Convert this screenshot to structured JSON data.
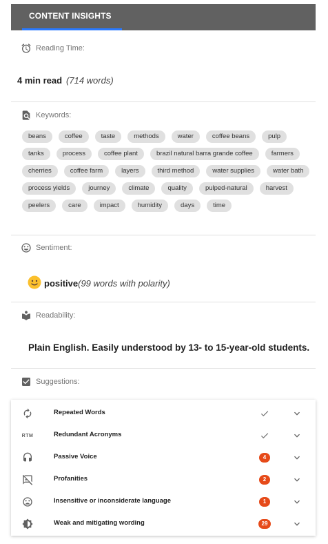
{
  "header": {
    "tab_label": "CONTENT INSIGHTS"
  },
  "reading_time": {
    "label": "Reading Time:",
    "value": "4 min read",
    "detail": "(714 words)"
  },
  "keywords": {
    "label": "Keywords:",
    "items": [
      "beans",
      "coffee",
      "taste",
      "methods",
      "water",
      "coffee beans",
      "pulp",
      "tanks",
      "process",
      "coffee plant",
      "brazil natural barra grande coffee",
      "farmers",
      "cherries",
      "coffee farm",
      "layers",
      "third method",
      "water supplies",
      "water bath",
      "process yields",
      "journey",
      "climate",
      "quality",
      "pulped-natural",
      "harvest",
      "peelers",
      "care",
      "impact",
      "humidity",
      "days",
      "time"
    ]
  },
  "sentiment": {
    "label": "Sentiment:",
    "value": "positive",
    "detail": "(99 words with polarity)"
  },
  "readability": {
    "label": "Readability:",
    "text": "Plain English. Easily understood by 13- to 15-year-old students."
  },
  "suggestions": {
    "label": "Suggestions:",
    "items": [
      {
        "label": "Repeated Words",
        "icon": "repeat-icon",
        "status": "check"
      },
      {
        "label": "Redundant Acronyms",
        "icon": "acronym-icon",
        "status": "check"
      },
      {
        "label": "Passive Voice",
        "icon": "headphones-icon",
        "status": "4"
      },
      {
        "label": "Profanities",
        "icon": "no-comment-icon",
        "status": "2"
      },
      {
        "label": "Insensitive or inconsiderate language",
        "icon": "sad-face-icon",
        "status": "1"
      },
      {
        "label": "Weak and mitigating wording",
        "icon": "brightness-icon",
        "status": "29"
      }
    ],
    "acronym_icon_text": "RTM"
  },
  "colors": {
    "header_bg": "#616161",
    "tab_accent": "#2979ff",
    "badge": "#e64a19",
    "chip_bg": "#e0e0e0"
  }
}
